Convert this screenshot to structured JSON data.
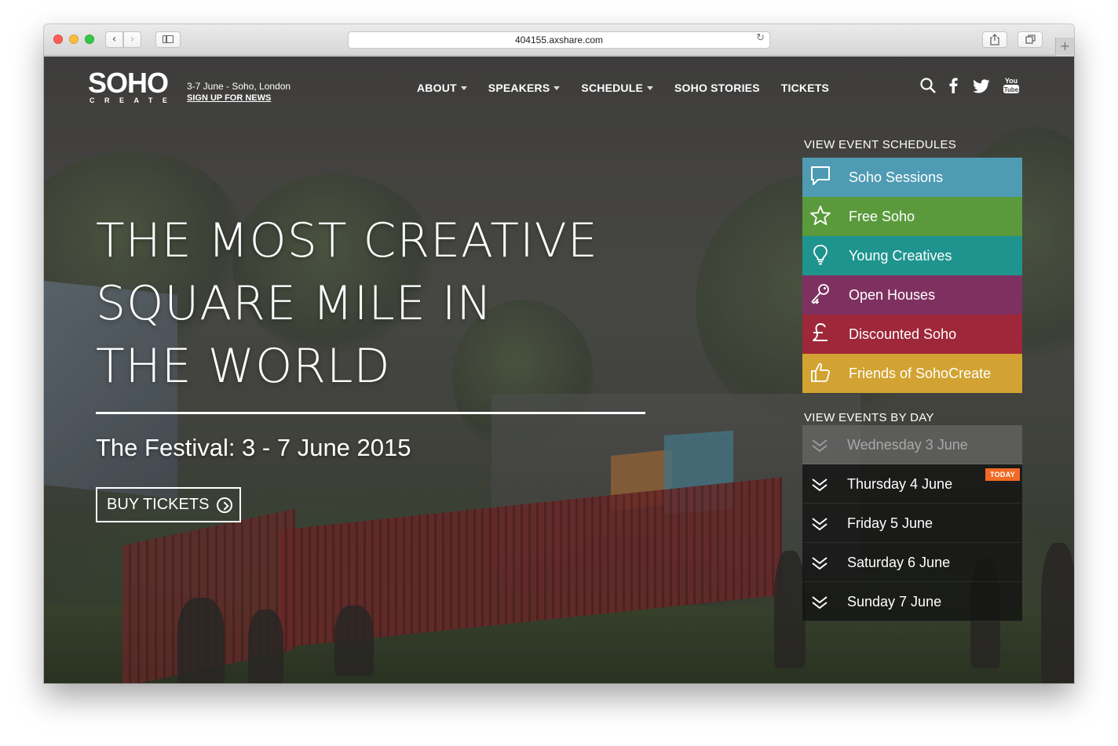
{
  "browser": {
    "url": "404155.axshare.com"
  },
  "header": {
    "logo_word": "SOHO",
    "logo_sub": "CREATE",
    "dates": "3-7 June - Soho, London",
    "signup": "SIGN UP FOR NEWS",
    "nav": [
      {
        "label": "ABOUT",
        "dropdown": true
      },
      {
        "label": "SPEAKERS",
        "dropdown": true
      },
      {
        "label": "SCHEDULE",
        "dropdown": true
      },
      {
        "label": "SOHO STORIES",
        "dropdown": false
      },
      {
        "label": "TICKETS",
        "dropdown": false
      }
    ],
    "social": [
      "search-icon",
      "facebook-icon",
      "twitter-icon",
      "youtube-icon"
    ]
  },
  "hero": {
    "title_lines": [
      "THE MOST CREATIVE",
      "SQUARE MILE IN",
      "THE WORLD"
    ],
    "festival": "The Festival: 3 - 7 June 2015",
    "buy_label": "BUY TICKETS"
  },
  "schedules": {
    "heading": "VIEW EVENT SCHEDULES",
    "items": [
      {
        "label": "Soho Sessions",
        "icon": "speech-bubble-icon",
        "color": "#4f9bb3"
      },
      {
        "label": "Free Soho",
        "icon": "star-icon",
        "color": "#5a9a3c"
      },
      {
        "label": "Young Creatives",
        "icon": "lightbulb-icon",
        "color": "#1f948f"
      },
      {
        "label": "Open Houses",
        "icon": "key-icon",
        "color": "#7e3160"
      },
      {
        "label": "Discounted Soho",
        "icon": "pound-icon",
        "color": "#9e2739"
      },
      {
        "label": "Friends of SohoCreate",
        "icon": "thumbs-up-icon",
        "color": "#d2a332"
      }
    ]
  },
  "days": {
    "heading": "VIEW EVENTS BY DAY",
    "today_badge": "TODAY",
    "items": [
      {
        "label": "Wednesday 3 June",
        "past": true,
        "today": false
      },
      {
        "label": "Thursday 4 June",
        "past": false,
        "today": true
      },
      {
        "label": "Friday 5 June",
        "past": false,
        "today": false
      },
      {
        "label": "Saturday 6 June",
        "past": false,
        "today": false
      },
      {
        "label": "Sunday 7 June",
        "past": false,
        "today": false
      }
    ]
  }
}
